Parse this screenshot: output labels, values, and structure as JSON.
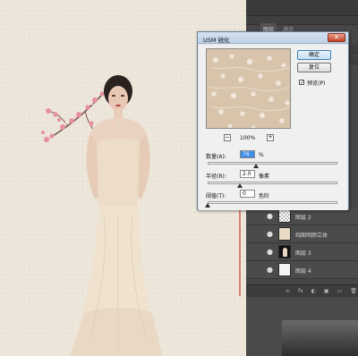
{
  "dialog": {
    "title": "USM 锐化",
    "close_glyph": "✕",
    "ok_label": "确定",
    "reset_label": "复位",
    "preview_checkbox": {
      "label": "预览(P)",
      "checked": true,
      "check_glyph": "✓"
    },
    "zoom": {
      "percent": "100%",
      "minus": "−",
      "plus": "+"
    },
    "amount": {
      "label": "数量(A):",
      "value": "76",
      "unit": "%",
      "fraction": 0.37
    },
    "radius": {
      "label": "半径(R):",
      "value": "2.0",
      "unit": "像素",
      "fraction": 0.25
    },
    "threshold": {
      "label": "阈值(T):",
      "value": "0",
      "unit": "色阶",
      "fraction": 0.0
    }
  },
  "panels": {
    "tabs": [
      "图层",
      "通道"
    ],
    "layers": [
      {
        "name": "图层 2",
        "thumb": "checker"
      },
      {
        "name": "纯图明颜立体",
        "thumb": "beige"
      },
      {
        "name": "图层 3",
        "thumb": "person"
      },
      {
        "name": "图层 4",
        "thumb": "white"
      }
    ],
    "eye_glyph": "●",
    "footer_icons": [
      "∞",
      "fx",
      "◐",
      "▣",
      "▭",
      "🗑"
    ]
  },
  "colors": {
    "canvas_bg": "#ede6db",
    "annotation_red": "#d1483d",
    "dialog_blue": "#bdd0e6"
  }
}
